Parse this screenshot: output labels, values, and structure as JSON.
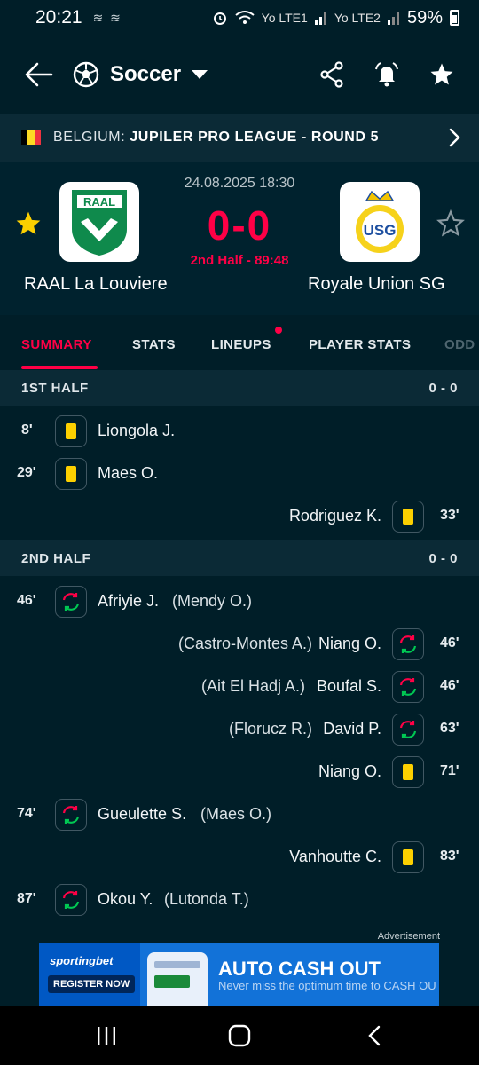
{
  "status_bar": {
    "time": "20:21",
    "left_icons": [
      "wind-icon",
      "wind-icon"
    ],
    "alarm": "alarm-icon",
    "sim1": "Yo LTE1",
    "sim2": "Yo LTE2",
    "battery": "59%"
  },
  "header": {
    "title": "Soccer"
  },
  "league": {
    "country": "BELGIUM:",
    "name": "JUPILER PRO LEAGUE - ROUND 5",
    "flag_colors": [
      "#000000",
      "#fdda24",
      "#ef3340"
    ]
  },
  "match": {
    "datetime": "24.08.2025 18:30",
    "score": "0-0",
    "status": "2nd Half - 89:48",
    "home": {
      "name": "RAAL La Louviere",
      "favorite": true,
      "logo_text": "RAAL"
    },
    "away": {
      "name": "Royale Union SG",
      "favorite": false,
      "logo_text": "USG"
    }
  },
  "tabs": [
    {
      "label": "SUMMARY",
      "active": true
    },
    {
      "label": "STATS",
      "active": false
    },
    {
      "label": "LINEUPS",
      "active": false,
      "dot": true
    },
    {
      "label": "PLAYER STATS",
      "active": false
    },
    {
      "label": "ODD",
      "active": false
    }
  ],
  "sections": {
    "first_half": {
      "title": "1ST HALF",
      "score": "0 - 0",
      "events": [
        {
          "side": "home",
          "minute": "8'",
          "type": "yellow-card",
          "player": "Liongola J."
        },
        {
          "side": "home",
          "minute": "29'",
          "type": "yellow-card",
          "player": "Maes O."
        },
        {
          "side": "away",
          "minute": "33'",
          "type": "yellow-card",
          "player": "Rodriguez K."
        }
      ]
    },
    "second_half": {
      "title": "2ND HALF",
      "score": "0 - 0",
      "events": [
        {
          "side": "home",
          "minute": "46'",
          "type": "substitution",
          "player": "Afriyie J.",
          "sub": "(Mendy O.)"
        },
        {
          "side": "away",
          "minute": "46'",
          "type": "substitution",
          "player": "Niang O.",
          "sub": "(Castro-Montes A.)"
        },
        {
          "side": "away",
          "minute": "46'",
          "type": "substitution",
          "player": "Boufal S.",
          "sub": "(Ait El Hadj A.)"
        },
        {
          "side": "away",
          "minute": "63'",
          "type": "substitution",
          "player": "David P.",
          "sub": "(Florucz R.)"
        },
        {
          "side": "away",
          "minute": "71'",
          "type": "yellow-card",
          "player": "Niang O."
        },
        {
          "side": "home",
          "minute": "74'",
          "type": "substitution",
          "player": "Gueulette S.",
          "sub": "(Maes O.)"
        },
        {
          "side": "away",
          "minute": "83'",
          "type": "yellow-card",
          "player": "Vanhoutte C."
        },
        {
          "side": "home",
          "minute": "87'",
          "type": "substitution",
          "player": "Okou Y.",
          "sub": "(Lutonda T.)"
        }
      ]
    }
  },
  "ad": {
    "label": "Advertisement",
    "brand": "sportingbet",
    "cta": "REGISTER NOW",
    "headline": "AUTO CASH OUT",
    "subline": "Never miss the optimum time to CASH OUT"
  },
  "colors": {
    "background": "#001e28",
    "accent": "#ff0046",
    "yellow_card": "#fcd000",
    "sub_in": "#00c853",
    "sub_out": "#ff0046",
    "star_active": "#fcd000"
  }
}
